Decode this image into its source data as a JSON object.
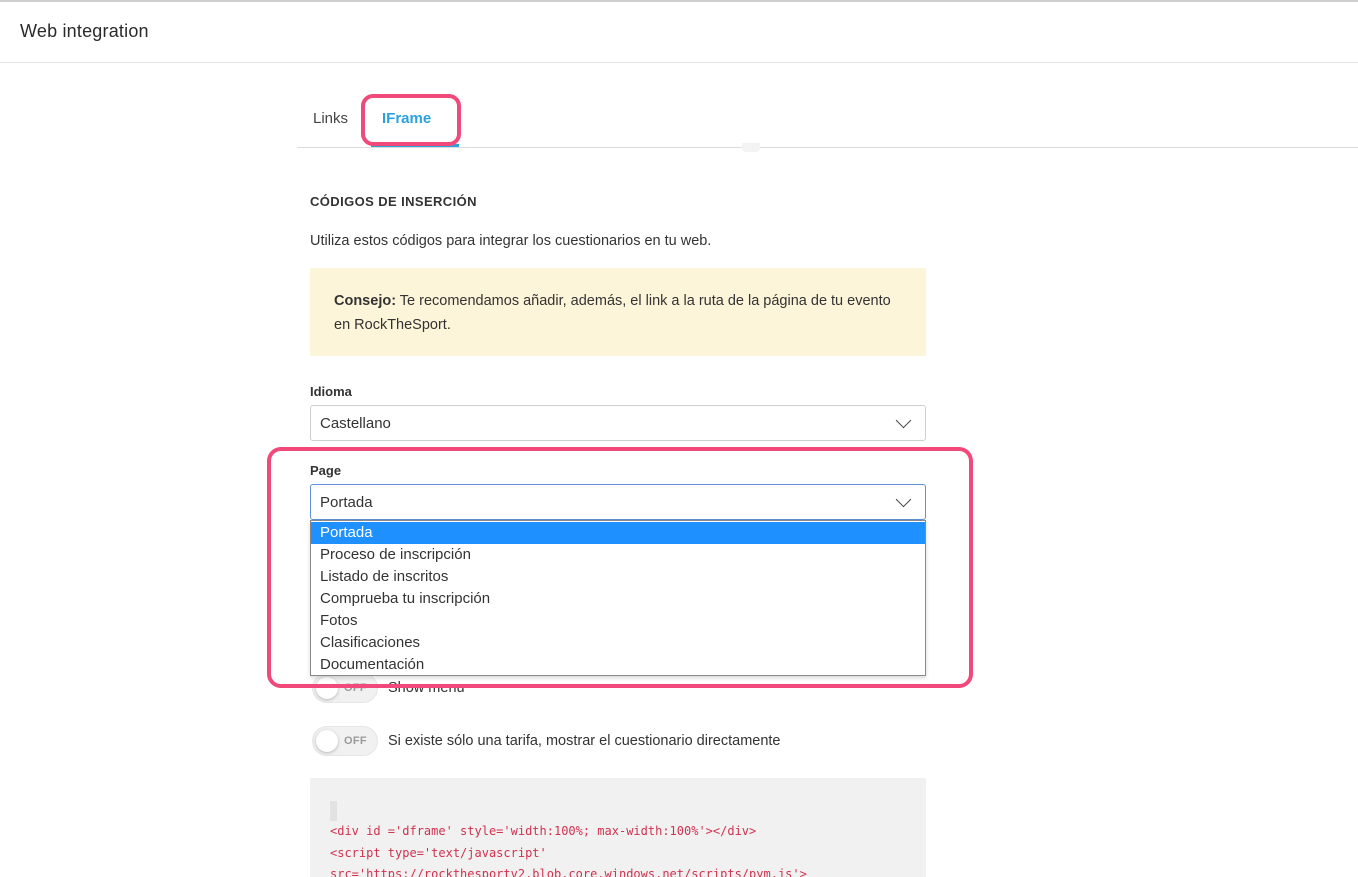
{
  "header": {
    "title": "Web integration"
  },
  "tabs": [
    {
      "label": "Links",
      "active": false
    },
    {
      "label": "IFrame",
      "active": true
    }
  ],
  "section": {
    "title": "CÓDIGOS DE INSERCIÓN",
    "intro": "Utiliza estos códigos para integrar los cuestionarios en tu web."
  },
  "tip": {
    "label": "Consejo:",
    "text": " Te recomendamos añadir, además, el link a la ruta de la página de tu evento en RockTheSport."
  },
  "language": {
    "label": "Idioma",
    "value": "Castellano"
  },
  "page": {
    "label": "Page",
    "value": "Portada",
    "options": [
      "Portada",
      "Proceso de inscripción",
      "Listado de inscritos",
      "Comprueba tu inscripción",
      "Fotos",
      "Clasificaciones",
      "Documentación"
    ],
    "selected_index": 0
  },
  "toggles": [
    {
      "state": "OFF",
      "label": "Show menu"
    },
    {
      "state": "OFF",
      "label": "Si existe sólo una tarifa, mostrar el cuestionario directamente"
    }
  ],
  "code": {
    "lines": [
      "<div id ='dframe' style='width:100%; max-width:100%'></div>",
      "<script type='text/javascript'",
      "src='https://rockthesportv2.blob.core.windows.net/scripts/pym.js'>"
    ]
  },
  "colors": {
    "accent": "#29a3dd",
    "highlight": "#f0497a",
    "selected_option": "#1e90ff",
    "tip_bg": "#fdf5d9",
    "code_text": "#d0324f"
  }
}
